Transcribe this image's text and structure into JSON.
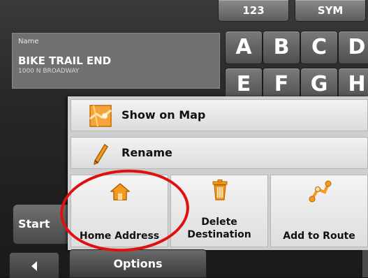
{
  "keyboard": {
    "mode_keys": [
      "123",
      "SYM"
    ],
    "letters_row1": [
      "A",
      "B",
      "C",
      "D"
    ],
    "letters_row2": [
      "E",
      "F",
      "G",
      "H"
    ]
  },
  "name_panel": {
    "label": "Name",
    "value": "BIKE TRAIL END",
    "address": "1000 N BROADWAY"
  },
  "start_button": {
    "label": "Start"
  },
  "popup": {
    "rows": [
      {
        "label": "Show on Map",
        "icon": "map-icon"
      },
      {
        "label": "Rename",
        "icon": "pencil-icon"
      }
    ],
    "tiles": [
      {
        "label": "Home Address",
        "icon": "home-icon"
      },
      {
        "label_line1": "Delete",
        "label_line2": "Destination",
        "icon": "trash-icon"
      },
      {
        "label": "Add to Route",
        "icon": "route-icon"
      }
    ],
    "tab_label": "Options"
  },
  "colors": {
    "highlight_ring": "#e01010",
    "icon_orange": "#f39a1f"
  }
}
